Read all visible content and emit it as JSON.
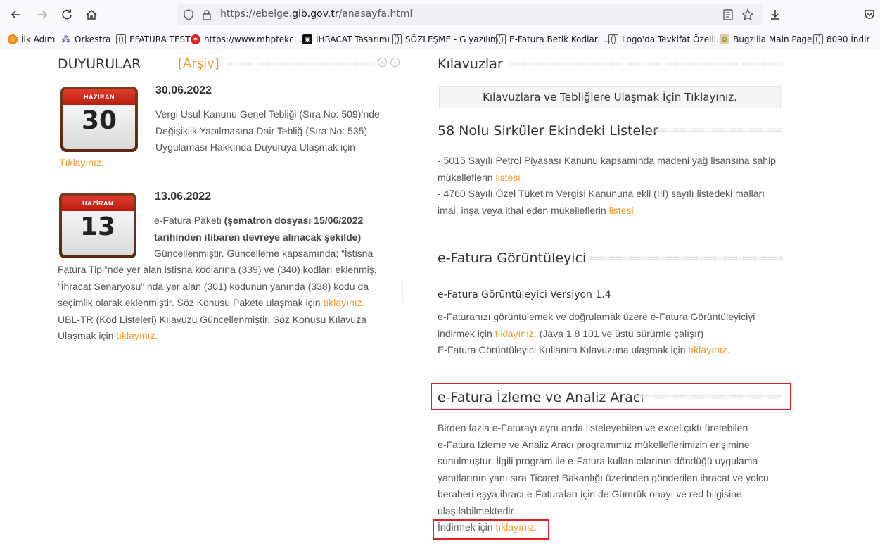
{
  "browser": {
    "url_prefix": "https://ebelge.",
    "url_domain": "gib.gov.tr",
    "url_suffix": "/anasayfa.html",
    "bookmarks": [
      {
        "label": "İlk Adım"
      },
      {
        "label": "Orkestra"
      },
      {
        "label": "EFATURA TEST"
      },
      {
        "label": "https://www.mhptekc..."
      },
      {
        "label": "İHRACAT Tasarımı"
      },
      {
        "label": "SÖZLEŞME - G yazılım"
      },
      {
        "label": "E-Fatura Betik Kodları ..."
      },
      {
        "label": "Logo'da Tevkifat Özelli..."
      },
      {
        "label": "Bugzilla Main Page"
      },
      {
        "label": "8090 İndir"
      }
    ]
  },
  "announcements": {
    "title": "DUYURULAR",
    "archive_link": "[Arşiv]",
    "items": [
      {
        "month": "HAZİRAN",
        "day": "30",
        "date": "30.06.2022",
        "line1": "Vergi Usul Kanunu Genel Tebliği (Sıra No: 509)’nde",
        "line2": "Değişiklik Yapılmasına Dair Tebliğ (Sıra No: 535)",
        "line3": "Uygulaması Hakkında Duyuruya Ulaşmak için",
        "link": "Tıklayınız."
      },
      {
        "month": "HAZİRAN",
        "day": "13",
        "date": "13.06.2022",
        "l1_a": "e-Fatura Paketi ",
        "l1_b": "(şematron dosyası 15/06/2022",
        "l2": "tarihinden itibaren devreye alınacak şekilde)",
        "l3": "Güncellenmiştir. Güncelleme kapsamında; “İstisna",
        "l4": "Fatura Tipi”nde yer alan istisna kodlarına (339) ve (340) kodları eklenmiş,",
        "l5": "“İhracat Senaryosu” nda yer alan (301) kodunun yanında (338) kodu da",
        "l6": "seçimlik olarak eklenmiştir. Söz Konusu Pakete ulaşmak için ",
        "l6_link": "tıklayınız.",
        "l7": "UBL-TR (Kod Listeleri) Kılavuzu Güncellenmiştir. Söz Konusu Kılavuza",
        "l8": "Ulaşmak için ",
        "l8_link": "tıklayınız."
      }
    ]
  },
  "guides": {
    "title": "Kılavuzlar",
    "box_link": "Kılavuzlara ve Tebliğlere Ulaşmak İçin Tıklayınız."
  },
  "circular": {
    "title": "58 Nolu Sirküler Ekindeki Listeler",
    "l1": "- 5015 Sayılı Petrol Piyasası Kanunu kapsamında madeni yağ lisansına sahip",
    "l2": "mükelleflerin ",
    "l2_link": "listesi",
    "l3": "- 4760 Sayılı Özel Tüketim Vergisi Kanununa ekli (III) sayılı listedeki malları",
    "l4": "imal, inşa veya ithal eden mükelleflerin ",
    "l4_link": "listesi"
  },
  "viewer": {
    "title": "e-Fatura Görüntüleyici",
    "version": "e-Fatura Görüntüleyici Versiyon 1.4",
    "l1": "e-Faturanızı görüntülemek ve doğrulamak üzere e-Fatura Görüntüleyiciyi",
    "l2_a": "indirmek için ",
    "l2_link": "tıklayınız.",
    "l2_b": " (Java 1.8 101 ve üstü sürümle çalışır)",
    "l3_a": "E-Fatura Görüntüleyici Kullanım Kılavuzuna ulaşmak için ",
    "l3_link": "tıklayınız."
  },
  "analysis": {
    "title": "e-Fatura İzleme ve Analiz Aracı",
    "l1": "Birden fazla e-Faturayı aynı anda listeleyebilen ve excel çıktı üretebilen",
    "l2": "e-Fatura İzleme ve Analiz Aracı programımız mükelleflerimizin erişimine",
    "l3": "sunulmuştur. İlgili program ile e-Fatura kullanıcılarının döndüğü uygulama",
    "l4": "yanıtlarının yanı sıra Ticaret Bakanlığı üzerinden gönderilen ihracat ve yolcu",
    "l5": "beraberi eşya ihracı e-Faturaları için de Gümrük onayı ve red bilgisine",
    "l6": "ulaşılabilmektedir.",
    "download_a": "İndirmek için ",
    "download_link": "tıklayınız."
  },
  "colors": {
    "accent": "#f29a2e",
    "highlight": "#e41e26"
  }
}
